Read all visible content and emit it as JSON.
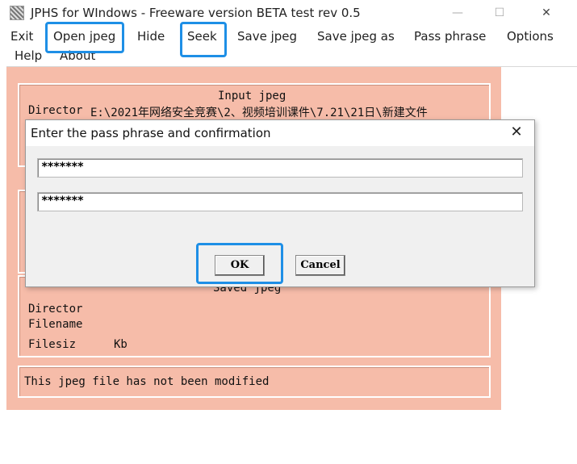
{
  "window": {
    "title": "JPHS for WIndows - Freeware version BETA test rev 0.5",
    "minimize_glyph": "—",
    "maximize_glyph": "☐",
    "close_glyph": "✕"
  },
  "menu": {
    "exit": "Exit",
    "open_jpeg": "Open jpeg",
    "hide": "Hide",
    "seek": "Seek",
    "save_jpeg": "Save jpeg",
    "save_jpeg_as": "Save jpeg as",
    "pass_phrase": "Pass phrase",
    "options": "Options",
    "help": "Help",
    "about": "About"
  },
  "input_group": {
    "header": "Input jpeg",
    "directory_label": "Director",
    "directory_value": "E:\\2021年网络安全竞赛\\2、视频培训课件\\7.21\\21日\\新建文件"
  },
  "saved_group": {
    "header": "Saved jpeg",
    "directory_label": "Director",
    "filename_label": "Filename",
    "filesize_label": "Filesiz",
    "filesize_unit": "Kb"
  },
  "status": {
    "message": "This jpeg file has not been modified"
  },
  "dialog": {
    "title": "Enter the pass phrase and confirmation",
    "close_glyph": "✕",
    "passphrase_value": "*******",
    "confirmation_value": "*******",
    "ok_label": "OK",
    "cancel_label": "Cancel"
  },
  "highlight_color": "#1e8fe6"
}
